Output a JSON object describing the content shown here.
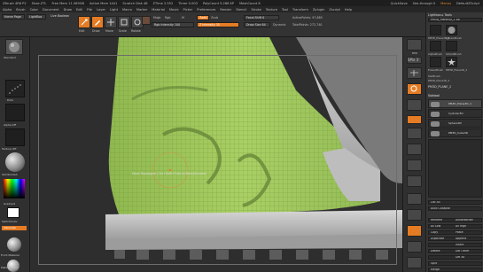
{
  "titlebar": {
    "app": "ZBrush 4R8 P2",
    "items": [
      "Shoe.ZTL",
      "Free Mem 11.569GB",
      "Active Mem 1441",
      "Scratch Disk 48",
      "ZTime 2.552",
      "Timer 0.003",
      "PolyCount 9.286 KP",
      "MeshCount 8"
    ],
    "quicksave": "QuickSave",
    "see_through": "See-through  0",
    "menus_btn": "Menus",
    "script": "DefaultZScript"
  },
  "menus": [
    "Alpha",
    "Brush",
    "Color",
    "Document",
    "Draw",
    "Edit",
    "File",
    "Layer",
    "Light",
    "Macro",
    "Marker",
    "Material",
    "Movie",
    "Picker",
    "Preferences",
    "Render",
    "Stencil",
    "Stroke",
    "Texture",
    "Tool",
    "Transform",
    "Zplugin",
    "Zscript",
    "Help"
  ],
  "shelf": {
    "home_page": "Home Page",
    "lightbox": "LightBox",
    "live_boolean": "Live Boolean",
    "edit": "Edit",
    "draw": "Draw",
    "move": "Move",
    "scale": "Scale",
    "rotate": "Rotate",
    "mrgb": "Mrgb",
    "rgb": "Rgb",
    "m": "M",
    "zadd": "Zadd",
    "zsub": "Zsub",
    "focal_shift": "Focal Shift 0",
    "z_intensity": "Z Intensity 35",
    "rgb_intensity": "Rgb Intensity 100",
    "draw_size": "Draw Size 64",
    "dynamic": "Dynamic",
    "active_points": "ActivePoints: 97,685",
    "total_points": "TotalPoints: 272,740"
  },
  "lefttray": {
    "standard": "Standard",
    "dots": "Dots",
    "alpha_off": "Alpha Off",
    "texture_off": "Texture Off",
    "skinshade": "SkinShade4",
    "gradient": "Gradient",
    "switchcolor": "SwitchColor",
    "alternate": "Alternate",
    "front_material": "Front Material",
    "matcap": "MatCap Gray"
  },
  "viewport": {
    "brush_label": "Move Topological  (Ctrl+Shift+Click to Mask/Unmask)",
    "floor": "Floor"
  },
  "rightshelf": [
    "BPR",
    "SPix 3",
    "Scroll",
    "Zoom",
    "Actual",
    "AAHalf",
    "Persp",
    "Floor",
    "Local",
    "L.Sym",
    "Frame",
    "Move",
    "Scale",
    "Rotate",
    "Line Fill",
    "Transp",
    "Ghost",
    "Solo",
    "Xpose"
  ],
  "rightpanel": {
    "lightbox_tools": "Lightbox ▸ Tools",
    "current_tool": "PM3D_Plane3D_1  48",
    "tools": [
      "PM3D_Plane3D_1",
      "SphereBrush",
      "AlphaBrush",
      "SimpleBrush",
      "EraserBrush",
      "PM3D_Plane3D_3",
      "TextBrush",
      "PM3D_Plane3D_4"
    ],
    "merge_label": "PM3D_PLANE_2",
    "subtool_header": "Subtool",
    "subtools": [
      "PM3D_Plane3D_1",
      "Cylinder3D",
      "Sphere3D",
      "PM3D_Cube3D"
    ],
    "list_all": "List All",
    "auto_collapse": "Auto Collapse",
    "rows": [
      [
        "Rename",
        "AutoReorder"
      ],
      [
        "All Low",
        "All High"
      ],
      [
        "Copy",
        "Paste"
      ],
      [
        "Duplicate",
        "Append"
      ],
      [
        "",
        "Insert"
      ],
      [
        "Delete",
        "Del Other"
      ],
      [
        "",
        "Del All"
      ],
      [
        "Split",
        ""
      ],
      [
        "Merge",
        ""
      ]
    ]
  },
  "colors": {
    "accent": "#e57c24",
    "mesh": "#9cc45a",
    "bg": "#2b2b2b"
  }
}
